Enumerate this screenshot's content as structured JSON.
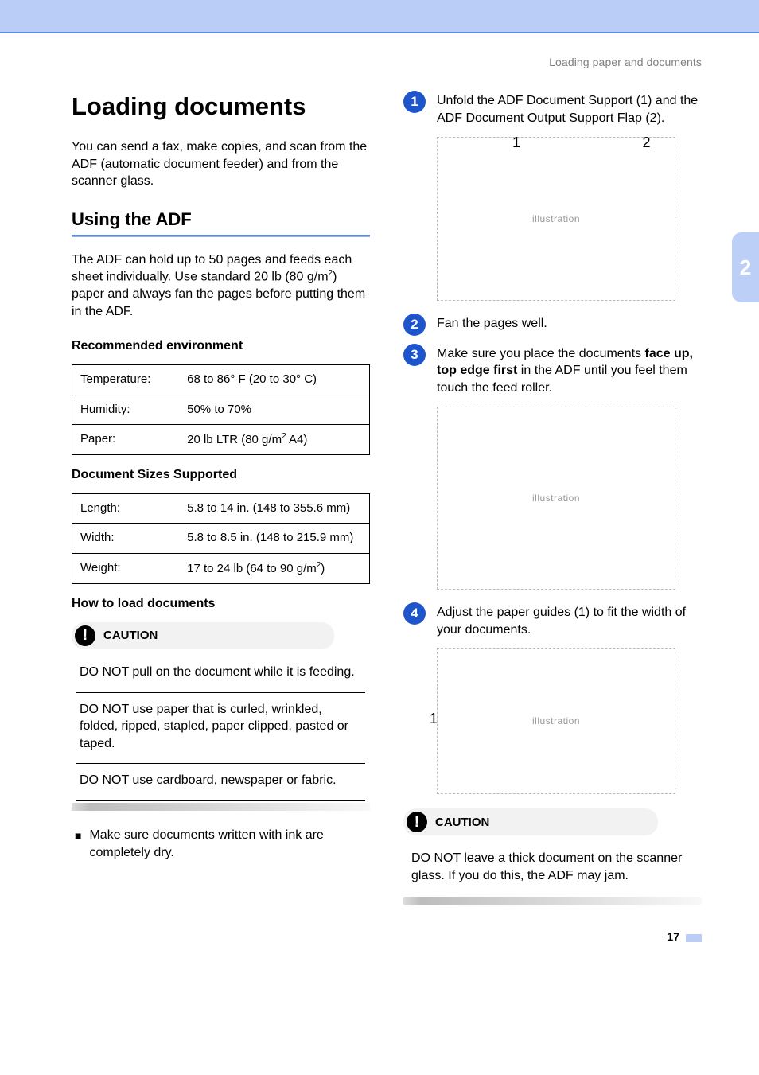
{
  "breadcrumb": "Loading paper and documents",
  "chapter_tab": "2",
  "h1": "Loading documents",
  "intro": "You can send a fax, make copies, and scan from the ADF (automatic document feeder) and from the scanner glass.",
  "h2_adf": "Using the ADF",
  "adf_text_a": "The ADF can hold up to 50 pages and feeds each sheet individually. Use standard 20 lb (80 g/m",
  "adf_text_b": ") paper and always fan the pages before putting them in the ADF.",
  "h3_env": "Recommended environment",
  "env": [
    {
      "label": "Temperature:",
      "value": "68 to 86° F (20 to 30° C)"
    },
    {
      "label": "Humidity:",
      "value": "50% to 70%"
    },
    {
      "label": "Paper:",
      "value_a": "20 lb LTR (80 g/m",
      "value_b": "  A4)"
    }
  ],
  "h3_sizes": "Document Sizes Supported",
  "sizes": [
    {
      "label": "Length:",
      "value": "5.8 to 14 in. (148 to 355.6 mm)"
    },
    {
      "label": "Width:",
      "value": "5.8 to 8.5 in. (148 to 215.9 mm)"
    },
    {
      "label": "Weight:",
      "value_a": "17 to 24 lb (64 to 90 g/m",
      "value_b": ")"
    }
  ],
  "h3_how": "How to load documents",
  "caution_label": "CAUTION",
  "caution_items_left": [
    "DO NOT pull on the document while it is feeding.",
    "DO NOT use paper that is curled, wrinkled, folded, ripped, stapled, paper clipped, pasted or taped.",
    "DO NOT use cardboard, newspaper or fabric."
  ],
  "ink_note": "Make sure documents written with ink are completely dry.",
  "steps": {
    "s1": "Unfold the ADF Document Support (1) and the ADF Document Output Support Flap (2).",
    "s2": "Fan the pages well.",
    "s3_a": "Make sure you place the documents ",
    "s3_b": "face up, top edge first",
    "s3_c": " in the ADF until you feel them touch the feed roller.",
    "s4": "Adjust the paper guides (1) to fit the width of your documents."
  },
  "caution_right": "DO NOT leave a thick document on the scanner glass. If you do this, the ADF may jam.",
  "callouts": {
    "c1": "1",
    "c2": "2",
    "c3": "1"
  },
  "page_number": "17",
  "illus_label": "illustration"
}
